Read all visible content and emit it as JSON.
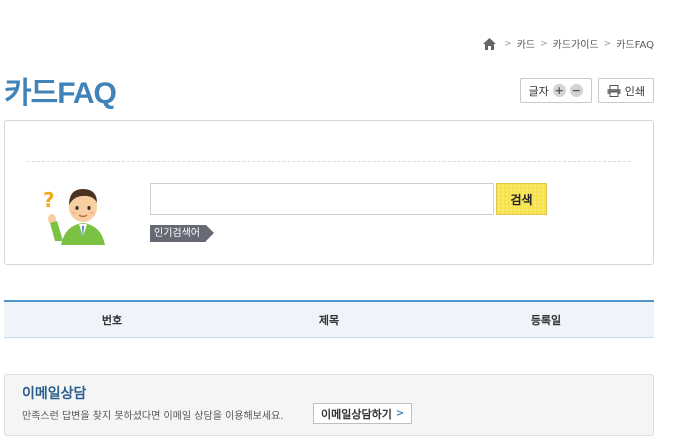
{
  "breadcrumb": {
    "home_icon": "home-icon",
    "items": [
      "카드",
      "카드가이드",
      "카드FAQ"
    ],
    "separator": ">"
  },
  "page": {
    "title": "카드FAQ"
  },
  "tools": {
    "font_label": "글자",
    "plus": "+",
    "minus": "−",
    "print_label": "인쇄",
    "print_icon": "printer-icon"
  },
  "search": {
    "input_value": "",
    "button_label": "검색",
    "popular_label": "인기검색어",
    "character_icon": "question-character-icon"
  },
  "table": {
    "headers": [
      "번호",
      "제목",
      "등록일"
    ]
  },
  "email": {
    "title": "이메일상담",
    "description": "만족스런 답변을 찾지 못하셨다면 이메일 상담을 이용해보세요.",
    "button_label": "이메일상담하기",
    "button_arrow": ">"
  },
  "colors": {
    "title_blue": "#3f83b9",
    "search_yellow": "#f7e34d",
    "header_bg": "#eef4f9",
    "header_border": "#4f95c9"
  }
}
